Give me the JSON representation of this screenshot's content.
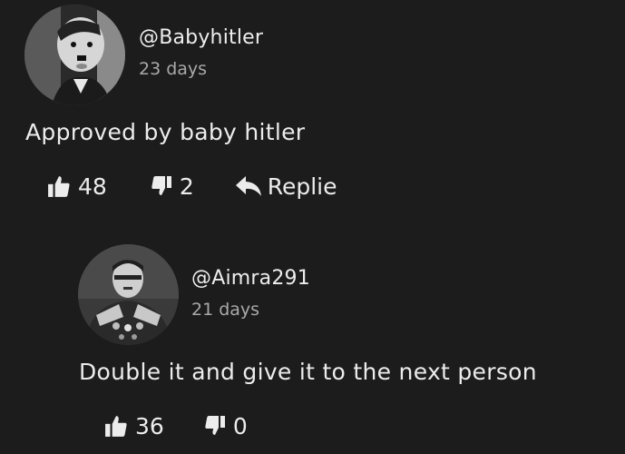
{
  "comments": [
    {
      "handle": "@Babyhitler",
      "time": "23 days",
      "text": "Approved by baby hitler",
      "likes": "48",
      "dislikes": "2",
      "reply_label": "Replie",
      "avatar_icon": "user-avatar"
    },
    {
      "handle": "@Aimra291",
      "time": "21 days",
      "text": "Double it and give it to the next person",
      "likes": "36",
      "dislikes": "0",
      "avatar_icon": "user-avatar"
    }
  ],
  "icons": {
    "like": "thumbs-up-icon",
    "dislike": "thumbs-down-icon",
    "reply": "reply-arrow-icon"
  }
}
